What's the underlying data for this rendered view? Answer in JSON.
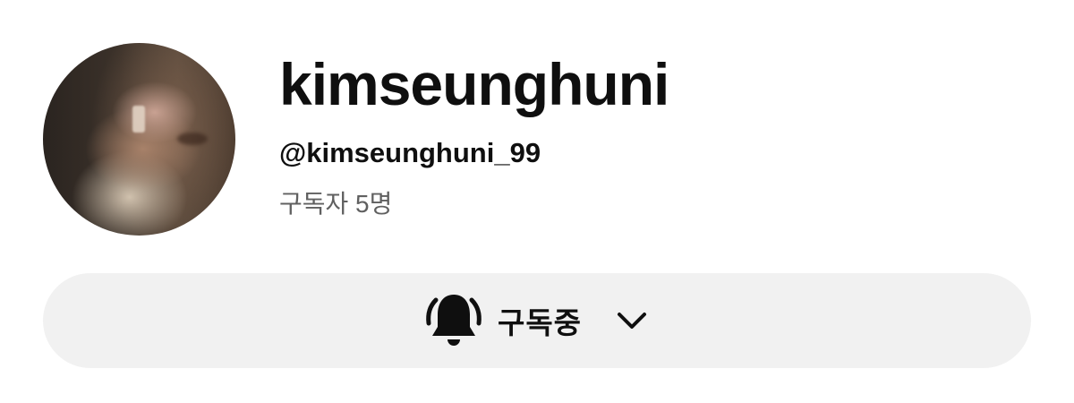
{
  "channel": {
    "name": "kimseunghuni",
    "handle": "@kimseunghuni_99",
    "subscribers": "구독자 5명"
  },
  "subscribe_button": {
    "label": "구독중",
    "icon": "bell-ringing-icon",
    "menu_icon": "chevron-down-icon"
  },
  "colors": {
    "text_primary": "#0f0f0f",
    "text_secondary": "#606060",
    "button_background": "#f1f1f1"
  }
}
